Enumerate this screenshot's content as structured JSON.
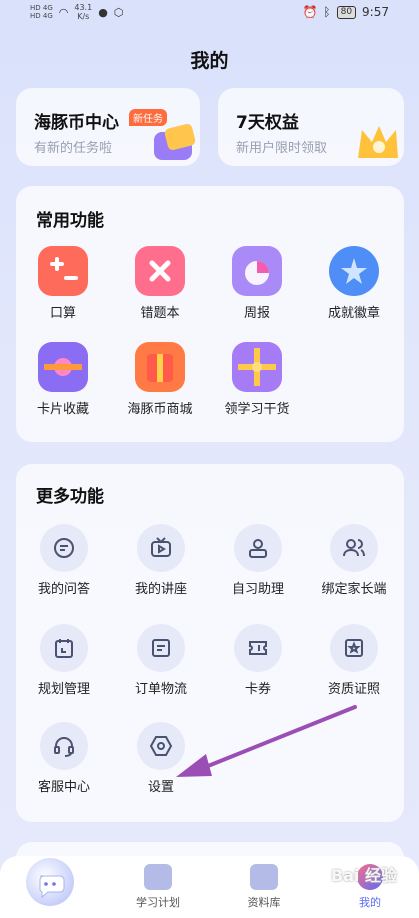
{
  "status": {
    "sim1": "HD 4G",
    "sim2": "HD 4G",
    "speed": "43.1",
    "speed_unit": "K/s",
    "battery": "80",
    "time": "9:57"
  },
  "header": {
    "title": "我的"
  },
  "top_cards": [
    {
      "title": "海豚币中心",
      "badge": "新任务",
      "subtitle": "有新的任务啦"
    },
    {
      "title": "7天权益",
      "subtitle": "新用户限时领取"
    }
  ],
  "common": {
    "title": "常用功能",
    "items": [
      {
        "label": "口算",
        "icon": "calculator-icon",
        "color": "#ff6b5a"
      },
      {
        "label": "错题本",
        "icon": "wrong-book-icon",
        "color": "#ff6f8d"
      },
      {
        "label": "周报",
        "icon": "weekly-report-icon",
        "color": "#a98af7"
      },
      {
        "label": "成就徽章",
        "icon": "badge-icon",
        "color": "#4f8df7"
      },
      {
        "label": "卡片收藏",
        "icon": "card-collection-icon",
        "color": "#8a6df2"
      },
      {
        "label": "海豚币商城",
        "icon": "gift-store-icon",
        "color": "#ff7a45"
      },
      {
        "label": "领学习干货",
        "icon": "gift-box-icon",
        "color": "#a57cf5"
      }
    ]
  },
  "more": {
    "title": "更多功能",
    "items": [
      {
        "label": "我的问答",
        "icon": "chat-icon"
      },
      {
        "label": "我的讲座",
        "icon": "tv-icon"
      },
      {
        "label": "自习助理",
        "icon": "user-badge-icon"
      },
      {
        "label": "绑定家长端",
        "icon": "users-icon"
      },
      {
        "label": "规划管理",
        "icon": "calendar-icon"
      },
      {
        "label": "订单物流",
        "icon": "document-icon"
      },
      {
        "label": "卡券",
        "icon": "ticket-icon"
      },
      {
        "label": "资质证照",
        "icon": "certificate-icon"
      },
      {
        "label": "客服中心",
        "icon": "headset-icon"
      },
      {
        "label": "设置",
        "icon": "settings-icon"
      }
    ]
  },
  "tabs": [
    {
      "label": "学习计划"
    },
    {
      "label": "资料库"
    },
    {
      "label": "我的"
    }
  ],
  "watermark": "Bai 经验",
  "colors": {
    "accent": "#5b6cf5",
    "arrow": "#9b4fb5",
    "icon_stroke": "#4a5272"
  }
}
